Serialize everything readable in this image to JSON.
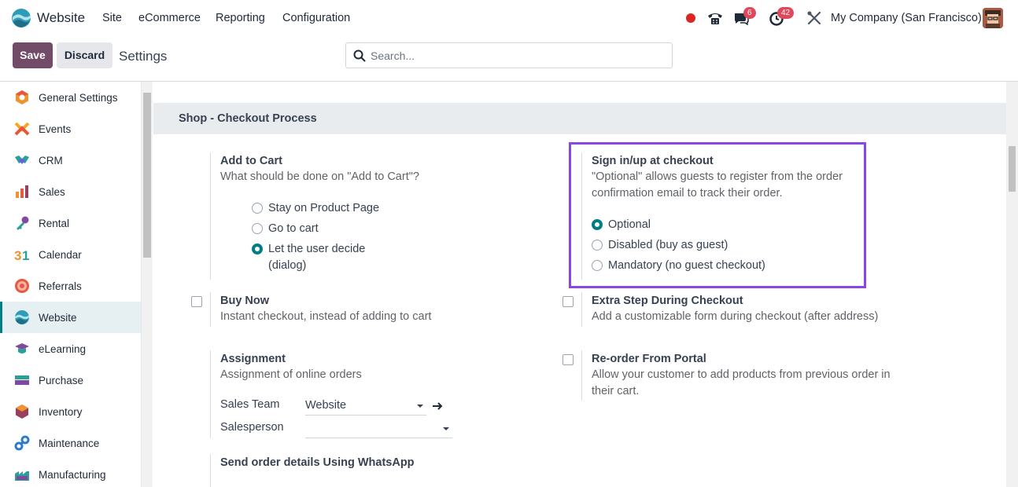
{
  "navbar": {
    "app_name": "Website",
    "menus": [
      "Site",
      "eCommerce",
      "Reporting",
      "Configuration"
    ],
    "chat_badge": "6",
    "activity_badge": "42",
    "company": "My Company (San Francisco)"
  },
  "control_panel": {
    "save_label": "Save",
    "discard_label": "Discard",
    "breadcrumb": "Settings",
    "search_placeholder": "Search..."
  },
  "sidebar": {
    "items": [
      {
        "label": "General Settings",
        "icon": "general-settings-icon"
      },
      {
        "label": "Events",
        "icon": "events-icon"
      },
      {
        "label": "CRM",
        "icon": "crm-icon"
      },
      {
        "label": "Sales",
        "icon": "sales-icon"
      },
      {
        "label": "Rental",
        "icon": "rental-icon"
      },
      {
        "label": "Calendar",
        "icon": "calendar-icon"
      },
      {
        "label": "Referrals",
        "icon": "referrals-icon"
      },
      {
        "label": "Website",
        "icon": "website-icon",
        "active": true
      },
      {
        "label": "eLearning",
        "icon": "elearning-icon"
      },
      {
        "label": "Purchase",
        "icon": "purchase-icon"
      },
      {
        "label": "Inventory",
        "icon": "inventory-icon"
      },
      {
        "label": "Maintenance",
        "icon": "maintenance-icon"
      },
      {
        "label": "Manufacturing",
        "icon": "manufacturing-icon"
      }
    ]
  },
  "section": {
    "title": "Shop - Checkout Process"
  },
  "add_to_cart": {
    "title": "Add to Cart",
    "desc": "What should be done on \"Add to Cart\"?",
    "options": [
      "Stay on Product Page",
      "Go to cart",
      "Let the user decide",
      "(dialog)"
    ],
    "selected": "Let the user decide (dialog)"
  },
  "sign_in": {
    "title": "Sign in/up at checkout",
    "desc_line1": "\"Optional\" allows guests to register from the order",
    "desc_line2": "confirmation email to track their order.",
    "options": [
      "Optional",
      "Disabled (buy as guest)",
      "Mandatory (no guest checkout)"
    ],
    "selected": "Optional"
  },
  "buy_now": {
    "title": "Buy Now",
    "desc": "Instant checkout, instead of adding to cart",
    "checked": false
  },
  "extra_step": {
    "title": "Extra Step During Checkout",
    "desc": "Add a customizable form during checkout (after address)",
    "checked": false
  },
  "assignment": {
    "title": "Assignment",
    "desc": "Assignment of online orders",
    "sales_team_label": "Sales Team",
    "sales_team_value": "Website",
    "salesperson_label": "Salesperson",
    "salesperson_value": ""
  },
  "reorder": {
    "title": "Re-order From Portal",
    "desc_line1": "Allow your customer to add products from previous order in",
    "desc_line2": "their cart.",
    "checked": false
  },
  "whatsapp": {
    "title": "Send order details Using WhatsApp"
  },
  "colors": {
    "brand": "#714b67",
    "accent": "#017e84",
    "highlight": "#8b45e6",
    "badge": "#e0475a"
  }
}
